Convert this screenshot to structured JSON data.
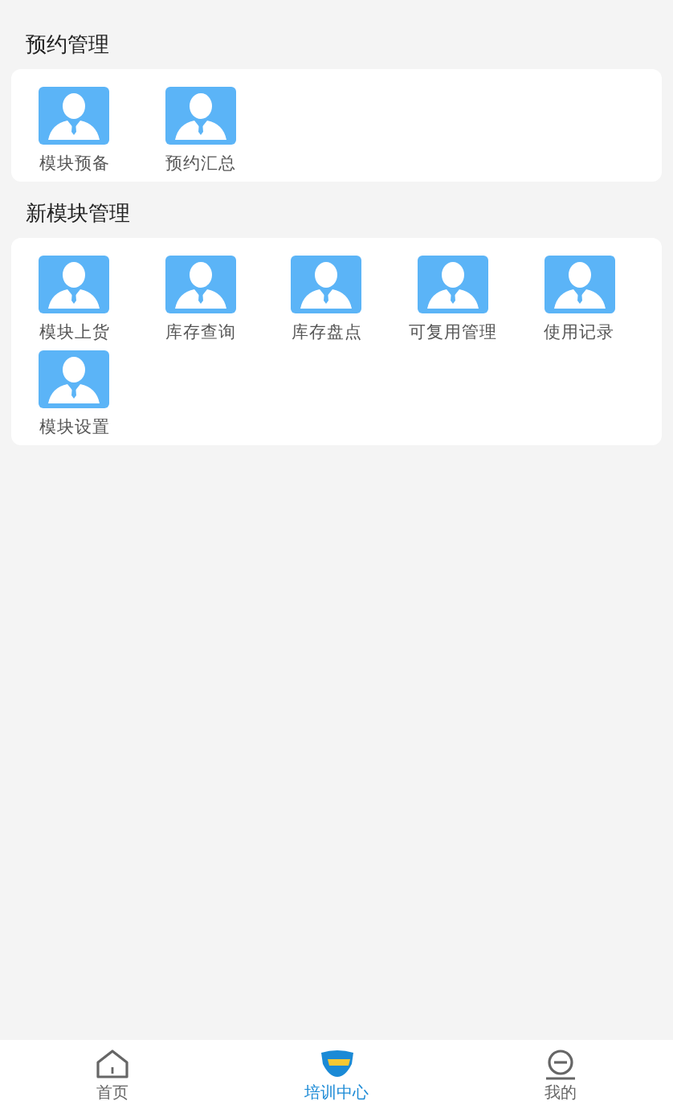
{
  "sections": [
    {
      "title": "预约管理",
      "items": [
        {
          "label": "模块预备"
        },
        {
          "label": "预约汇总"
        }
      ]
    },
    {
      "title": "新模块管理",
      "items": [
        {
          "label": "模块上货"
        },
        {
          "label": "库存查询"
        },
        {
          "label": "库存盘点"
        },
        {
          "label": "可复用管理"
        },
        {
          "label": "使用记录"
        },
        {
          "label": "模块设置"
        }
      ]
    }
  ],
  "tabbar": [
    {
      "kind": "home",
      "label": "首页",
      "selected": false
    },
    {
      "kind": "training",
      "label": "培训中心",
      "selected": true
    },
    {
      "kind": "mine",
      "label": "我的",
      "selected": false
    }
  ]
}
